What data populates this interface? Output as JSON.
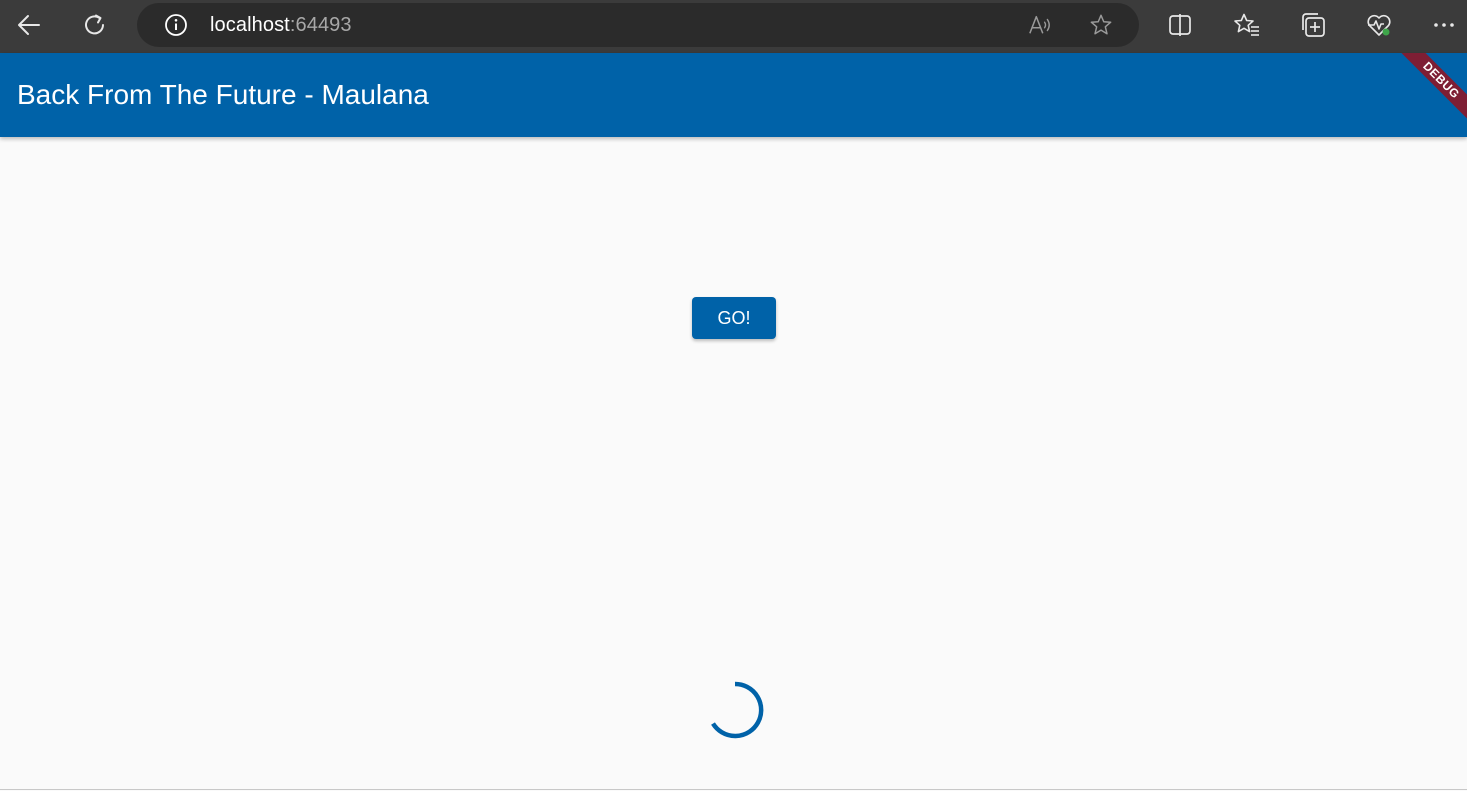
{
  "browser": {
    "url_host": "localhost",
    "url_port": ":64493",
    "icons": {
      "back": "back-arrow-icon",
      "refresh": "refresh-icon",
      "site_info": "info-icon",
      "read_aloud": "read-aloud-icon",
      "favorite": "star-icon",
      "split_screen": "split-screen-icon",
      "favorites": "favorites-icon",
      "collections": "collections-icon",
      "performance": "heartbeat-icon",
      "more": "more-icon"
    }
  },
  "app_bar": {
    "title": "Back From The Future - Maulana",
    "debug_label": "DEBUG"
  },
  "main": {
    "go_button_label": "GO!"
  },
  "colors": {
    "primary": "#0062a8",
    "debug_ribbon": "#7e1e34",
    "background": "#fafafa",
    "browser_chrome": "#3b3b3b"
  }
}
